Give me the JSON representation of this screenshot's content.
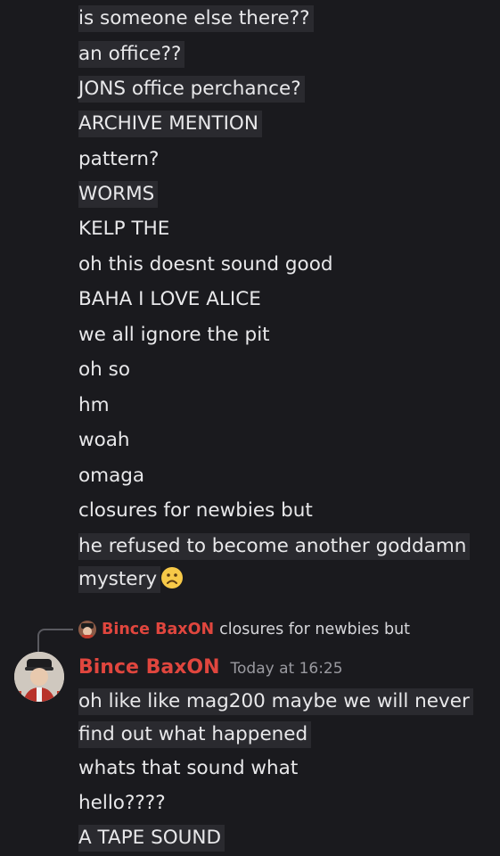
{
  "messages_top": [
    {
      "text": "is someone else there??",
      "highlight": true
    },
    {
      "text": "an office??",
      "highlight": true
    },
    {
      "text": "JONS office perchance?",
      "highlight": true
    },
    {
      "text": "ARCHIVE MENTION",
      "highlight": true
    },
    {
      "text": "pattern?",
      "highlight": false
    },
    {
      "text": "WORMS",
      "highlight": true
    },
    {
      "text": "KELP THE",
      "highlight": false
    },
    {
      "text": "oh this doesnt sound good",
      "highlight": false
    },
    {
      "text": "BAHA I LOVE ALICE",
      "highlight": false
    },
    {
      "text": "we all ignore the pit",
      "highlight": false
    },
    {
      "text": "oh so",
      "highlight": false
    },
    {
      "text": "hm",
      "highlight": false
    },
    {
      "text": "woah",
      "highlight": false
    },
    {
      "text": "omaga",
      "highlight": false
    },
    {
      "text": "closures for newbies but",
      "highlight": false
    },
    {
      "text": "he refused to become another goddamn",
      "highlight": true
    },
    {
      "text": "mystery",
      "highlight": true,
      "emoji": "frowning-face"
    }
  ],
  "reply": {
    "author": "Bince BaxON",
    "text": "closures for newbies but"
  },
  "message": {
    "author": "Bince BaxON",
    "timestamp": "Today at 16:25",
    "author_color": "#e0463e",
    "lines": [
      {
        "text": "oh like like mag200 maybe we will never",
        "highlight": true
      },
      {
        "text": "find out what happened",
        "highlight": true
      },
      {
        "text": "whats that sound what",
        "highlight": false
      },
      {
        "text": "hello????",
        "highlight": false
      },
      {
        "text": "A TAPE SOUND",
        "highlight": true
      }
    ]
  }
}
